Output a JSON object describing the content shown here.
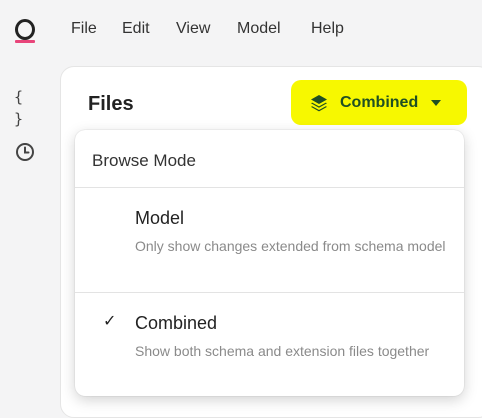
{
  "menubar": {
    "items": [
      {
        "label": "File"
      },
      {
        "label": "Edit"
      },
      {
        "label": "View"
      },
      {
        "label": "Model"
      },
      {
        "label": "Help"
      }
    ]
  },
  "sidebar": {
    "icons": [
      {
        "name": "braces-icon",
        "glyph": "{ }"
      },
      {
        "name": "history-icon"
      }
    ]
  },
  "files": {
    "title": "Files"
  },
  "mode_button": {
    "label": "Combined",
    "icon": "layers-icon",
    "highlight_color": "#f7f800",
    "text_color": "#1f4f23"
  },
  "browse_mode": {
    "title": "Browse Mode",
    "options": [
      {
        "name": "Model",
        "description": "Only show changes extended from schema model",
        "selected": false
      },
      {
        "name": "Combined",
        "description": "Show both schema and extension files together",
        "selected": true
      }
    ],
    "check_glyph": "✓"
  },
  "colors": {
    "logo_accent": "#e8457a"
  }
}
